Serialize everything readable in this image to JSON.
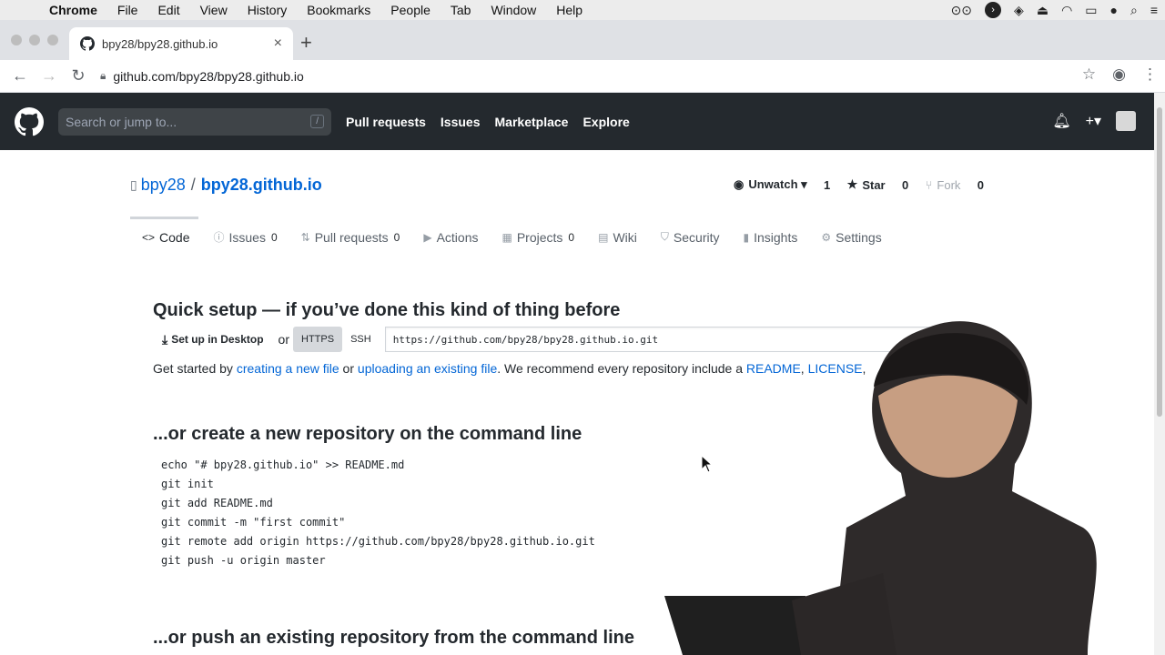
{
  "menubar": {
    "apple_icon": "apple-icon",
    "app": "Chrome",
    "items": [
      "File",
      "Edit",
      "View",
      "History",
      "Bookmarks",
      "People",
      "Tab",
      "Window",
      "Help"
    ]
  },
  "browser": {
    "tab_title": "bpy28/bpy28.github.io",
    "tab_close": "×",
    "new_tab": "+",
    "url": "github.com/bpy28/bpy28.github.io"
  },
  "github": {
    "search_placeholder": "Search or jump to...",
    "search_shortcut": "/",
    "nav": [
      "Pull requests",
      "Issues",
      "Marketplace",
      "Explore"
    ],
    "plus": "+▾"
  },
  "repo": {
    "owner": "bpy28",
    "separator": "/",
    "name": "bpy28.github.io",
    "unwatch_label": "Unwatch ▾",
    "watch_count": "1",
    "star_label": "Star",
    "star_count": "0",
    "fork_label": "Fork",
    "fork_count": "0"
  },
  "tabs": [
    {
      "icon": "<>",
      "label": "Code"
    },
    {
      "icon": "ⓘ",
      "label": "Issues",
      "count": "0"
    },
    {
      "icon": "⇅",
      "label": "Pull requests",
      "count": "0"
    },
    {
      "icon": "▶",
      "label": "Actions"
    },
    {
      "icon": "▦",
      "label": "Projects",
      "count": "0"
    },
    {
      "icon": "▤",
      "label": "Wiki"
    },
    {
      "icon": "⛉",
      "label": "Security"
    },
    {
      "icon": "▮",
      "label": "Insights"
    },
    {
      "icon": "⚙",
      "label": "Settings"
    }
  ],
  "quick_setup": {
    "title": "Quick setup — if you’ve done this kind of thing before",
    "desktop_button": "Set up in Desktop",
    "or": "or",
    "https_label": "HTTPS",
    "ssh_label": "SSH",
    "clone_url": "https://github.com/bpy28/bpy28.github.io.git",
    "started_prefix": "Get started by ",
    "link_new_file": "creating a new file",
    "middle": " or ",
    "link_upload": "uploading an existing file",
    "suffix": ". We recommend every repository include a ",
    "link_readme": "README",
    "comma": ", ",
    "link_license": "LICENSE",
    "tail": ","
  },
  "create_section": {
    "title": "...or create a new repository on the command line",
    "code": "echo \"# bpy28.github.io\" >> README.md\ngit init\ngit add README.md\ngit commit -m \"first commit\"\ngit remote add origin https://github.com/bpy28/bpy28.github.io.git\ngit push -u origin master"
  },
  "push_section": {
    "title": "...or push an existing repository from the command line"
  },
  "colors": {
    "header_bg": "#24292e",
    "link": "#0366d6",
    "text": "#24292e"
  }
}
